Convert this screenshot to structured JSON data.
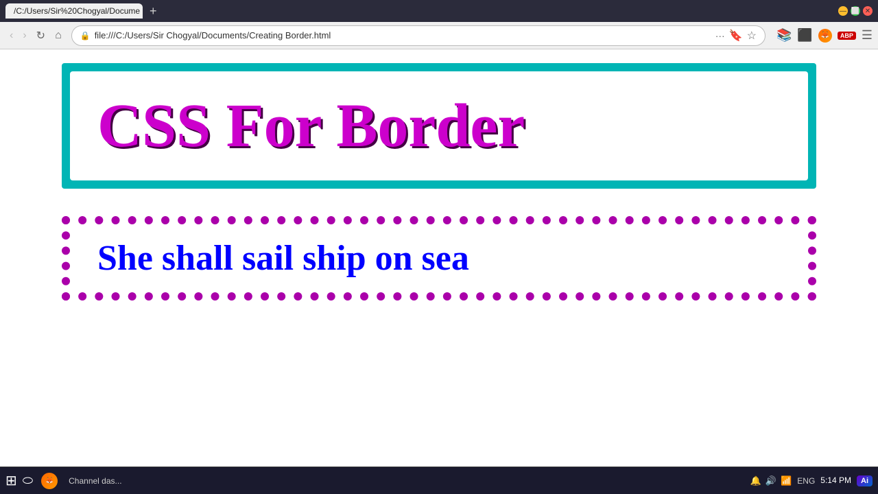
{
  "browser": {
    "tab": {
      "title": "/C:/Users/Sir%20Chogyal/Docume",
      "active": true
    },
    "address": "file:///C:/Users/Sir Chogyal/Documents/Creating Border.html",
    "lock_icon": "🔒",
    "new_tab": "+",
    "window_controls": {
      "minimize": "—",
      "maximize": "⬜",
      "close": "✕"
    }
  },
  "nav": {
    "back": "‹",
    "forward": "›",
    "refresh": "↻",
    "home": "⌂",
    "more": "···",
    "bookmark_star": "☆",
    "bookmark_save": "🔖"
  },
  "page": {
    "heading": "CSS For Border",
    "paragraph": "She shall sail ship on sea"
  },
  "taskbar": {
    "start_icon": "⊞",
    "search_icon": "⬭",
    "time": "5:14 PM",
    "lang": "ENG",
    "firefox_label": "Channel das...",
    "ai_label": "Ai",
    "apps": []
  }
}
